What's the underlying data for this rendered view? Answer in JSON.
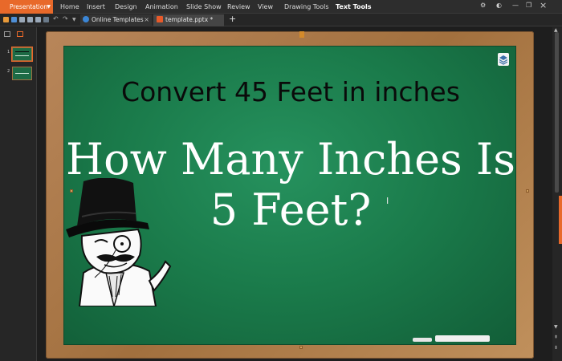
{
  "app": {
    "menu_button_label": "Presentation",
    "menu_tabs": [
      "Home",
      "Insert",
      "Design",
      "Animation",
      "Slide Show",
      "Review",
      "View",
      "Drawing Tools",
      "Text Tools"
    ]
  },
  "tabs": {
    "online_templates": "Online Templates",
    "template_file": "template.pptx *",
    "new_tab": "+"
  },
  "slide": {
    "title": "Convert 45 Feet in inches",
    "question_line1": "How Many Inches Is",
    "question_line2": "5 Feet?"
  },
  "thumbnails": [
    {
      "number": "1"
    },
    {
      "number": "2"
    }
  ],
  "colors": {
    "accent": "#e8692a",
    "chalkboard": "#1a7a4a",
    "frame": "#a2703e"
  },
  "icons": {
    "window_controls": [
      "settings-icon",
      "skin-icon",
      "minimize-icon",
      "restore-icon",
      "close-icon"
    ],
    "layers": "layers-icon"
  }
}
